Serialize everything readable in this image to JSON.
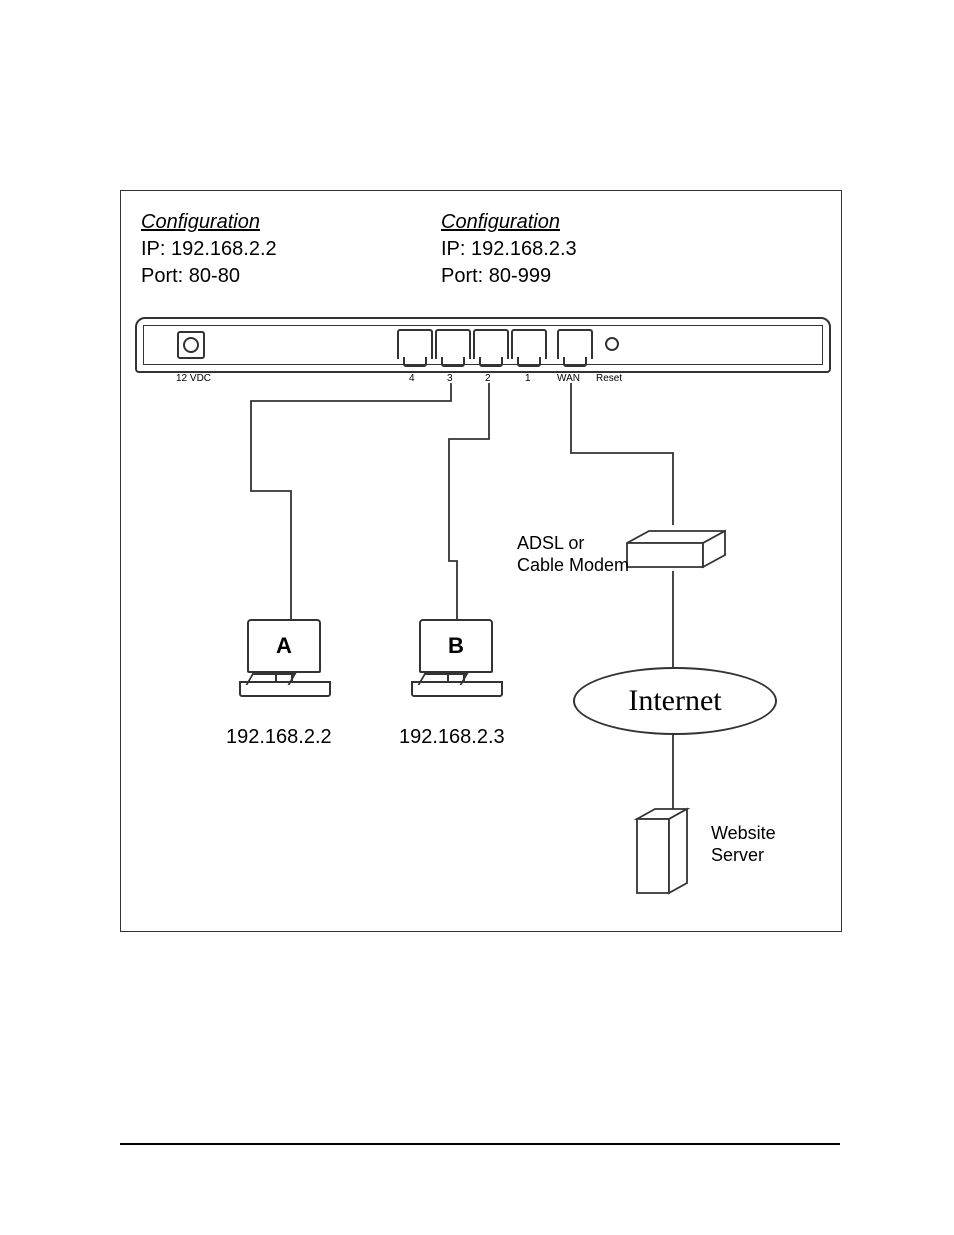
{
  "config_a": {
    "title": "Configuration",
    "ip_label": "IP: 192.168.2.2",
    "port_label": "Port: 80-80"
  },
  "config_b": {
    "title": "Configuration",
    "ip_label": "IP: 192.168.2.3",
    "port_label": "Port: 80-999"
  },
  "router": {
    "power_label": "12 VDC",
    "ports": [
      "4",
      "3",
      "2",
      "1"
    ],
    "wan_label": "WAN",
    "reset_label": "Reset"
  },
  "pc_a": {
    "letter": "A",
    "ip": "192.168.2.2"
  },
  "pc_b": {
    "letter": "B",
    "ip": "192.168.2.3"
  },
  "modem_label_line1": "ADSL or",
  "modem_label_line2": "Cable Modem",
  "internet_label": "Internet",
  "server_label_line1": "Website",
  "server_label_line2": "Server"
}
